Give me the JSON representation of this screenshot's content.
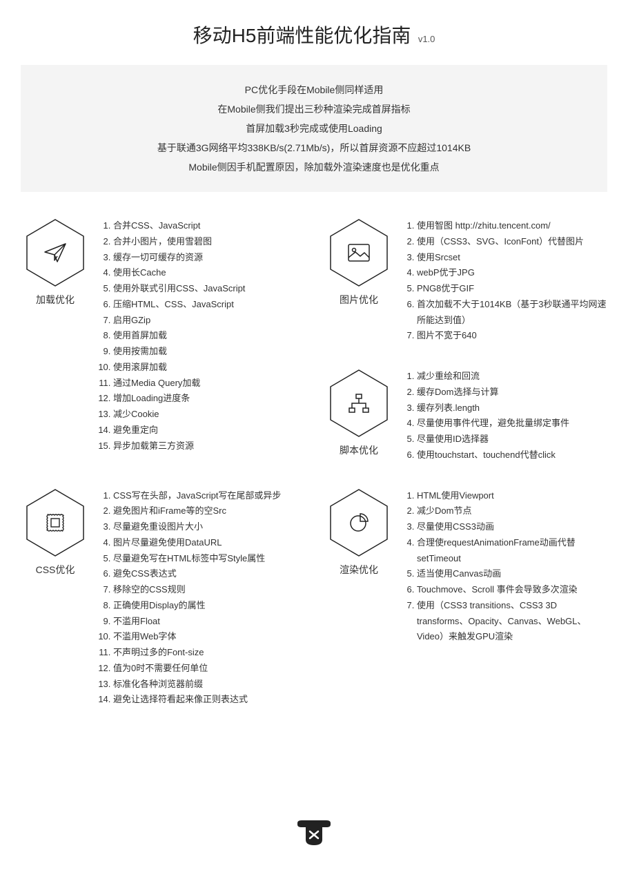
{
  "title": "移动H5前端性能优化指南",
  "version": "v1.0",
  "intro": [
    "PC优化手段在Mobile侧同样适用",
    "在Mobile侧我们提出三秒种渲染完成首屏指标",
    "首屏加载3秒完成或使用Loading",
    "基于联通3G网络平均338KB/s(2.71Mb/s)，所以首屏资源不应超过1014KB",
    "Mobile侧因手机配置原因，除加载外渲染速度也是优化重点"
  ],
  "sections": {
    "load": {
      "title": "加载优化",
      "items": [
        "合并CSS、JavaScript",
        "合并小图片，使用雪碧图",
        "缓存一切可缓存的资源",
        "使用长Cache",
        "使用外联式引用CSS、JavaScript",
        "压缩HTML、CSS、JavaScript",
        "启用GZip",
        "使用首屏加载",
        "使用按需加载",
        "使用滚屏加载",
        "通过Media Query加载",
        "增加Loading进度条",
        "减少Cookie",
        "避免重定向",
        "异步加载第三方资源"
      ]
    },
    "image": {
      "title": "图片优化",
      "items": [
        "使用智图 http://zhitu.tencent.com/",
        "使用（CSS3、SVG、IconFont）代替图片",
        "使用Srcset",
        "webP优于JPG",
        "PNG8优于GIF",
        "首次加载不大于1014KB（基于3秒联通平均网速所能达到值）",
        "图片不宽于640"
      ]
    },
    "script": {
      "title": "脚本优化",
      "items": [
        "减少重绘和回流",
        "缓存Dom选择与计算",
        "缓存列表.length",
        "尽量使用事件代理，避免批量绑定事件",
        "尽量使用ID选择器",
        "使用touchstart、touchend代替click"
      ]
    },
    "css": {
      "title": "CSS优化",
      "items": [
        "CSS写在头部，JavaScript写在尾部或异步",
        "避免图片和iFrame等的空Src",
        "尽量避免重设图片大小",
        "图片尽量避免使用DataURL",
        "尽量避免写在HTML标签中写Style属性",
        "避免CSS表达式",
        "移除空的CSS规则",
        "正确使用Display的属性",
        "不滥用Float",
        "不滥用Web字体",
        "不声明过多的Font-size",
        "值为0时不需要任何单位",
        "标准化各种浏览器前缀",
        "避免让选择符看起来像正则表达式"
      ]
    },
    "render": {
      "title": "渲染优化",
      "items": [
        "HTML使用Viewport",
        "减少Dom节点",
        "尽量使用CSS3动画",
        "合理使requestAnimationFrame动画代替setTimeout",
        "适当使用Canvas动画",
        "Touchmove、Scroll 事件会导致多次渲染",
        "使用（CSS3 transitions、CSS3 3D transforms、Opacity、Canvas、WebGL、Video）来触发GPU渲染"
      ]
    }
  }
}
